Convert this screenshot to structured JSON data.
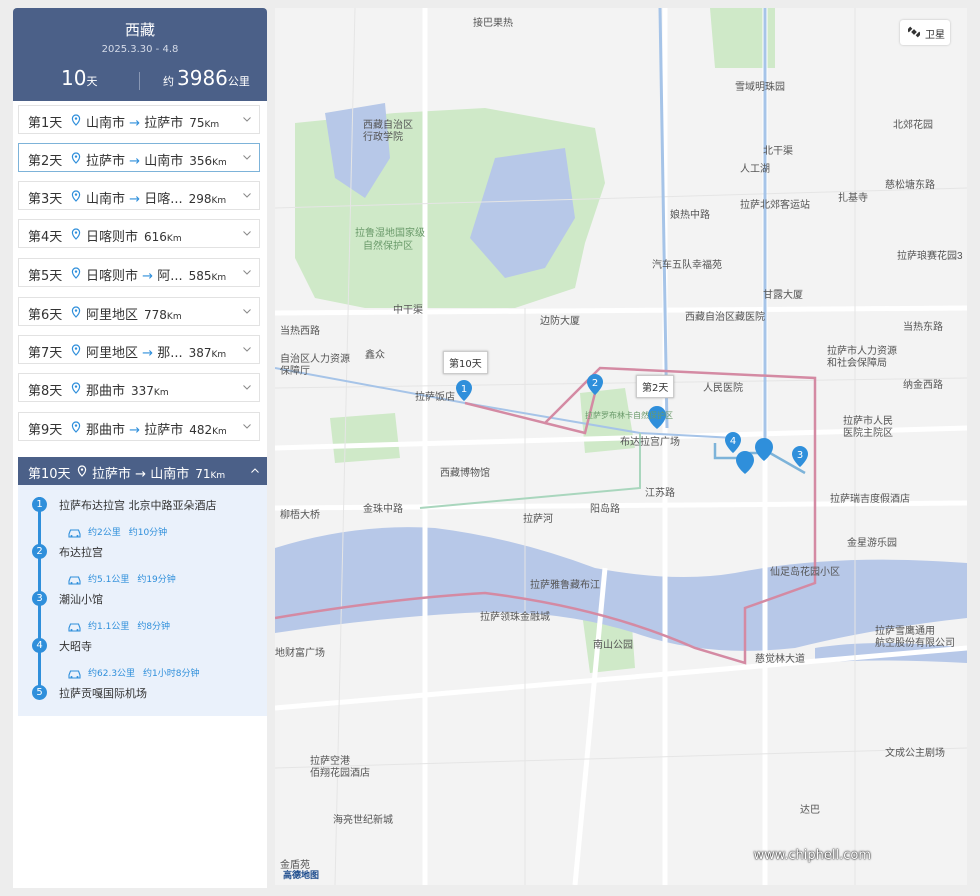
{
  "trip": {
    "title": "西藏",
    "dates": "2025.3.30 - 4.8",
    "days_value": "10",
    "days_unit": "天",
    "km_prefix": "约",
    "km_value": "3986",
    "km_unit": "公里"
  },
  "days": [
    {
      "label": "第1天",
      "route_from": "山南市",
      "route_to": "拉萨市",
      "dist": "75",
      "unit": "Km"
    },
    {
      "label": "第2天",
      "route_from": "拉萨市",
      "route_to": "山南市",
      "dist": "356",
      "unit": "Km"
    },
    {
      "label": "第3天",
      "route_from": "山南市",
      "route_to": "日喀...",
      "dist": "298",
      "unit": "Km"
    },
    {
      "label": "第4天",
      "route_from": "日喀则市",
      "route_to": "",
      "dist": "616",
      "unit": "Km"
    },
    {
      "label": "第5天",
      "route_from": "日喀则市",
      "route_to": "阿...",
      "dist": "585",
      "unit": "Km"
    },
    {
      "label": "第6天",
      "route_from": "阿里地区",
      "route_to": "",
      "dist": "778",
      "unit": "Km"
    },
    {
      "label": "第7天",
      "route_from": "阿里地区",
      "route_to": "那...",
      "dist": "387",
      "unit": "Km"
    },
    {
      "label": "第8天",
      "route_from": "那曲市",
      "route_to": "",
      "dist": "337",
      "unit": "Km"
    },
    {
      "label": "第9天",
      "route_from": "那曲市",
      "route_to": "拉萨市",
      "dist": "482",
      "unit": "Km"
    }
  ],
  "open_day": {
    "label": "第10天",
    "route_from": "拉萨市",
    "route_to": "山南市",
    "dist": "71",
    "unit": "Km",
    "stops": [
      {
        "num": "1",
        "name": "拉萨布达拉宫 北京中路亚朵酒店"
      },
      {
        "num": "2",
        "name": "布达拉宫"
      },
      {
        "num": "3",
        "name": "潮汕小馆"
      },
      {
        "num": "4",
        "name": "大昭寺"
      },
      {
        "num": "5",
        "name": "拉萨贡嘎国际机场"
      }
    ],
    "segments": [
      {
        "dist": "约2公里",
        "time": "约10分钟"
      },
      {
        "dist": "约5.1公里",
        "time": "约19分钟"
      },
      {
        "dist": "约1.1公里",
        "time": "约8分钟"
      },
      {
        "dist": "约62.3公里",
        "time": "约1小时8分钟"
      }
    ]
  },
  "map": {
    "satellite_label": "卫星",
    "tip_day10": "第10天",
    "tip_day2": "第2天",
    "markers": [
      "1",
      "2",
      "3",
      "4"
    ],
    "labels": [
      {
        "t": "接巴果热"
      },
      {
        "t": "雪域明珠园"
      },
      {
        "t": "北郊花园"
      },
      {
        "t": "西藏自治区"
      },
      {
        "t": "行政学院"
      },
      {
        "t": "北干渠"
      },
      {
        "t": "人工湖"
      },
      {
        "t": "拉萨北郊客运站"
      },
      {
        "t": "扎基寺"
      },
      {
        "t": "慈松塘东路"
      },
      {
        "t": "拉萨市人力资源"
      },
      {
        "t": "和社会保障局"
      },
      {
        "t": "拉萨市人民"
      },
      {
        "t": "医院主院区"
      },
      {
        "t": "娘热中路"
      },
      {
        "t": "汽车五队幸福苑"
      },
      {
        "t": "拉萨琅赛花园3"
      },
      {
        "t": "甘露大厦"
      },
      {
        "t": "中干渠"
      },
      {
        "t": "边防大厦"
      },
      {
        "t": "西藏自治区藏医院"
      },
      {
        "t": "当热西路"
      },
      {
        "t": "当热东路"
      },
      {
        "t": "自治区人力资源"
      },
      {
        "t": "保障厅"
      },
      {
        "t": "鑫众"
      },
      {
        "t": "拉萨饭店"
      },
      {
        "t": "人民医院"
      },
      {
        "t": "布达拉宫广场"
      },
      {
        "t": "纳金西路"
      },
      {
        "t": "西藏博物馆"
      },
      {
        "t": "江苏路"
      },
      {
        "t": "金珠中路"
      },
      {
        "t": "拉萨瑞吉度假酒店"
      },
      {
        "t": "柳梧大桥"
      },
      {
        "t": "拉萨河"
      },
      {
        "t": "阳岛路"
      },
      {
        "t": "金星游乐园"
      },
      {
        "t": "仙足岛花园小区"
      },
      {
        "t": "拉萨雅鲁藏布江"
      },
      {
        "t": "拉萨领珠金融城"
      },
      {
        "t": "南山公园"
      },
      {
        "t": "拉萨雪鹰通用"
      },
      {
        "t": "航空股份有限公司"
      },
      {
        "t": "慈觉林大道"
      },
      {
        "t": "地财富广场"
      },
      {
        "t": "拉萨空港"
      },
      {
        "t": "佰翔花园酒店"
      },
      {
        "t": "文成公主剧场"
      },
      {
        "t": "海亮世纪新城"
      },
      {
        "t": "金盾苑"
      },
      {
        "t": "达巴"
      },
      {
        "t": "拉萨罗布林卡自然保护区"
      },
      {
        "t": "拉鲁湿地国家级"
      },
      {
        "t": "自然保护区"
      }
    ],
    "brand": "高德地图",
    "watermark": "www.chiphell.com"
  }
}
